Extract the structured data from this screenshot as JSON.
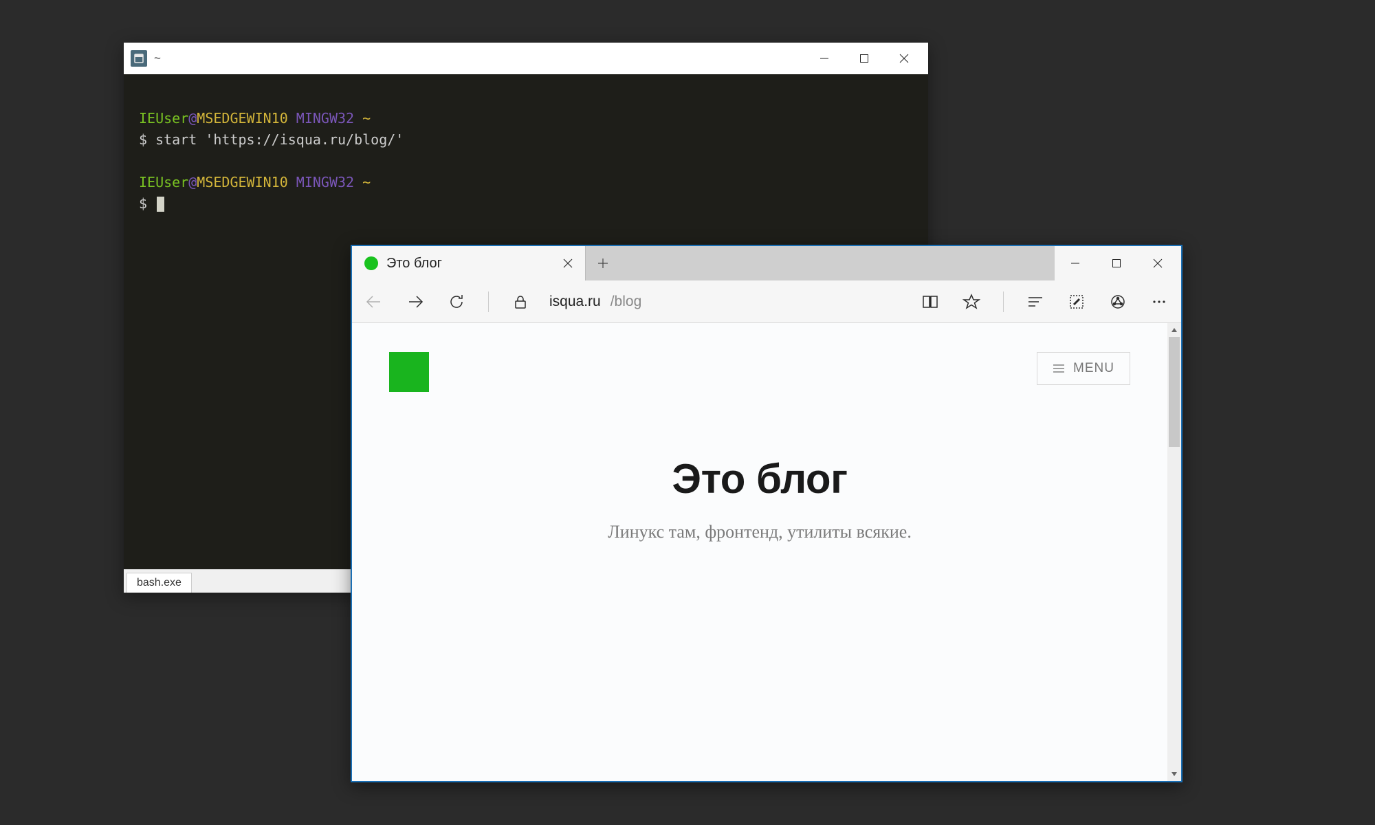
{
  "terminal": {
    "title": "~",
    "user": "IEUser",
    "at": "@",
    "host": "MSEDGEWIN10",
    "shell": "MINGW32",
    "path": "~",
    "prompt": "$",
    "command": "start 'https://isqua.ru/blog/'",
    "taskbar_tab": "bash.exe"
  },
  "browser": {
    "tab_title": "Это блог",
    "url_host": "isqua.ru",
    "url_path": "/blog",
    "page": {
      "menu_label": "MENU",
      "heading": "Это блог",
      "subtitle": "Линукс там, фронтенд, утилиты всякие."
    }
  }
}
